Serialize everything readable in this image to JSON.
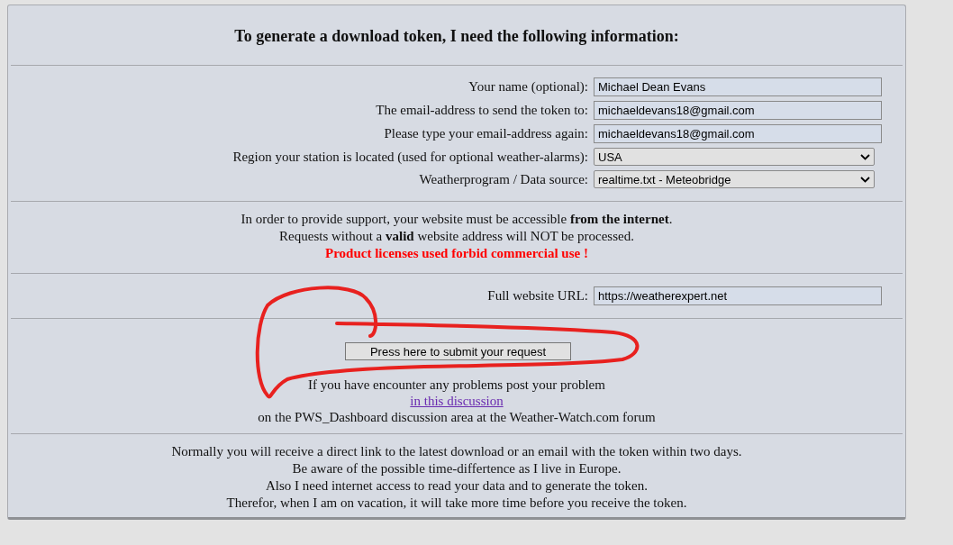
{
  "title": "To generate a download token, I need the following information:",
  "fields": [
    {
      "kind": "text",
      "label": "Your name (optional):",
      "value": "Michael Dean Evans"
    },
    {
      "kind": "text",
      "label": "The email-address to send the token to:",
      "value": "michaeldevans18@gmail.com"
    },
    {
      "kind": "text",
      "label": "Please type your email-address again:",
      "value": "michaeldevans18@gmail.com"
    },
    {
      "kind": "select",
      "label": "Region your station is located (used for optional weather-alarms):",
      "value": "USA"
    },
    {
      "kind": "select",
      "label": "Weatherprogram / Data source:",
      "value": "realtime.txt - Meteobridge"
    }
  ],
  "notice": [
    "In order to provide support, your website must be accessible **from the internet**.",
    "Requests without a **valid** website address will NOT be processed."
  ],
  "warning": "Product licenses used forbid commercial use !",
  "url_field": {
    "label": "Full website URL:",
    "value": "https://weatherexpert.net"
  },
  "submit_button": "Press here to submit your request",
  "help": {
    "before": "If you have encounter any problems post your problem",
    "link": "in this discussion",
    "after": "on the PWS_Dashboard discussion area at the Weather-Watch.com forum"
  },
  "footer": [
    "Normally you will receive a direct link to the latest download or an email with the token within two days.",
    "Be aware of the possible time-differtence as I live in Europe.",
    "Also I need internet access to read your data and to generate the token.",
    "Therefor, when I am on vacation, it will take more time before you receive the token."
  ]
}
